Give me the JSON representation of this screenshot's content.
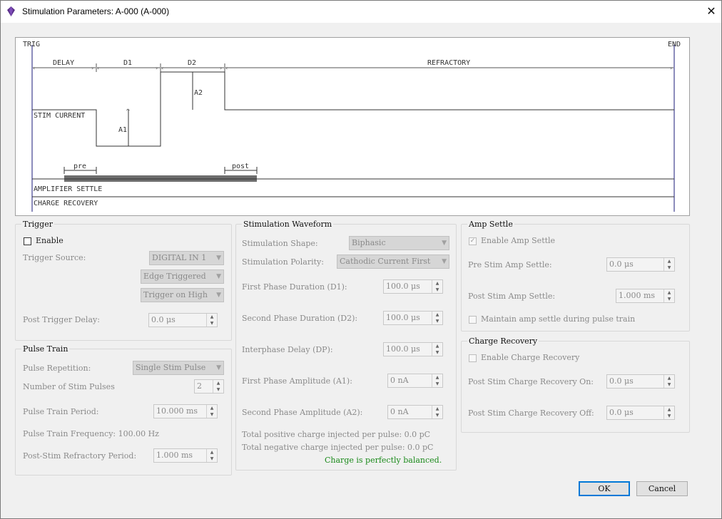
{
  "window": {
    "title": "Stimulation Parameters: A-000 (A-000)",
    "close_glyph": "✕",
    "icon": "purple-gem-icon"
  },
  "diagram": {
    "trig": "TRIG",
    "end": "END",
    "delay": "DELAY",
    "d1": "D1",
    "d2": "D2",
    "refractory": "REFRACTORY",
    "a1": "A1",
    "a2": "A2",
    "stim_current": "STIM CURRENT",
    "pre": "pre",
    "post": "post",
    "amp_settle": "AMPLIFIER SETTLE",
    "charge_recovery": "CHARGE RECOVERY"
  },
  "trigger": {
    "title": "Trigger",
    "enable_label": "Enable",
    "enable_checked": false,
    "source_label": "Trigger Source:",
    "source_value": "DIGITAL IN 1",
    "edge_value": "Edge Triggered",
    "polarity_value": "Trigger on High",
    "post_delay_label": "Post Trigger Delay:",
    "post_delay_value": "0.0 μs"
  },
  "pulse_train": {
    "title": "Pulse Train",
    "repetition_label": "Pulse Repetition:",
    "repetition_value": "Single Stim Pulse",
    "num_pulses_label": "Number of Stim Pulses",
    "num_pulses_value": "2",
    "period_label": "Pulse Train Period:",
    "period_value": "10.000 ms",
    "frequency_text": "Pulse Train Frequency: 100.00 Hz",
    "refractory_label": "Post-Stim Refractory Period:",
    "refractory_value": "1.000 ms"
  },
  "waveform": {
    "title": "Stimulation Waveform",
    "shape_label": "Stimulation Shape:",
    "shape_value": "Biphasic",
    "polarity_label": "Stimulation Polarity:",
    "polarity_value": "Cathodic Current First",
    "d1_label": "First Phase Duration (D1):",
    "d1_value": "100.0 μs",
    "d2_label": "Second Phase Duration (D2):",
    "d2_value": "100.0 μs",
    "dp_label": "Interphase Delay (DP):",
    "dp_value": "100.0 μs",
    "a1_label": "First Phase Amplitude (A1):",
    "a1_value": "0 nA",
    "a2_label": "Second Phase Amplitude (A2):",
    "a2_value": "0 nA",
    "pos_charge": "Total positive charge injected per pulse: 0.0 pC",
    "neg_charge": "Total negative charge injected per pulse: 0.0 pC",
    "balance": "Charge is perfectly balanced."
  },
  "amp_settle": {
    "title": "Amp Settle",
    "enable_label": "Enable Amp Settle",
    "enable_checked": true,
    "pre_label": "Pre Stim Amp Settle:",
    "pre_value": "0.0 μs",
    "post_label": "Post Stim Amp Settle:",
    "post_value": "1.000 ms",
    "maintain_label": "Maintain amp settle during pulse train",
    "maintain_checked": false
  },
  "charge_recovery": {
    "title": "Charge Recovery",
    "enable_label": "Enable Charge Recovery",
    "enable_checked": false,
    "on_label": "Post Stim Charge Recovery On:",
    "on_value": "0.0 μs",
    "off_label": "Post Stim Charge Recovery Off:",
    "off_value": "0.0 μs"
  },
  "buttons": {
    "ok": "OK",
    "cancel": "Cancel"
  },
  "colors": {
    "accent": "#0078d7",
    "balance_text": "#1a8a1a",
    "stim_bar": "#6e6e6e",
    "trig_line": "#1a1a7a",
    "app_icon": "#5a2f8a"
  }
}
